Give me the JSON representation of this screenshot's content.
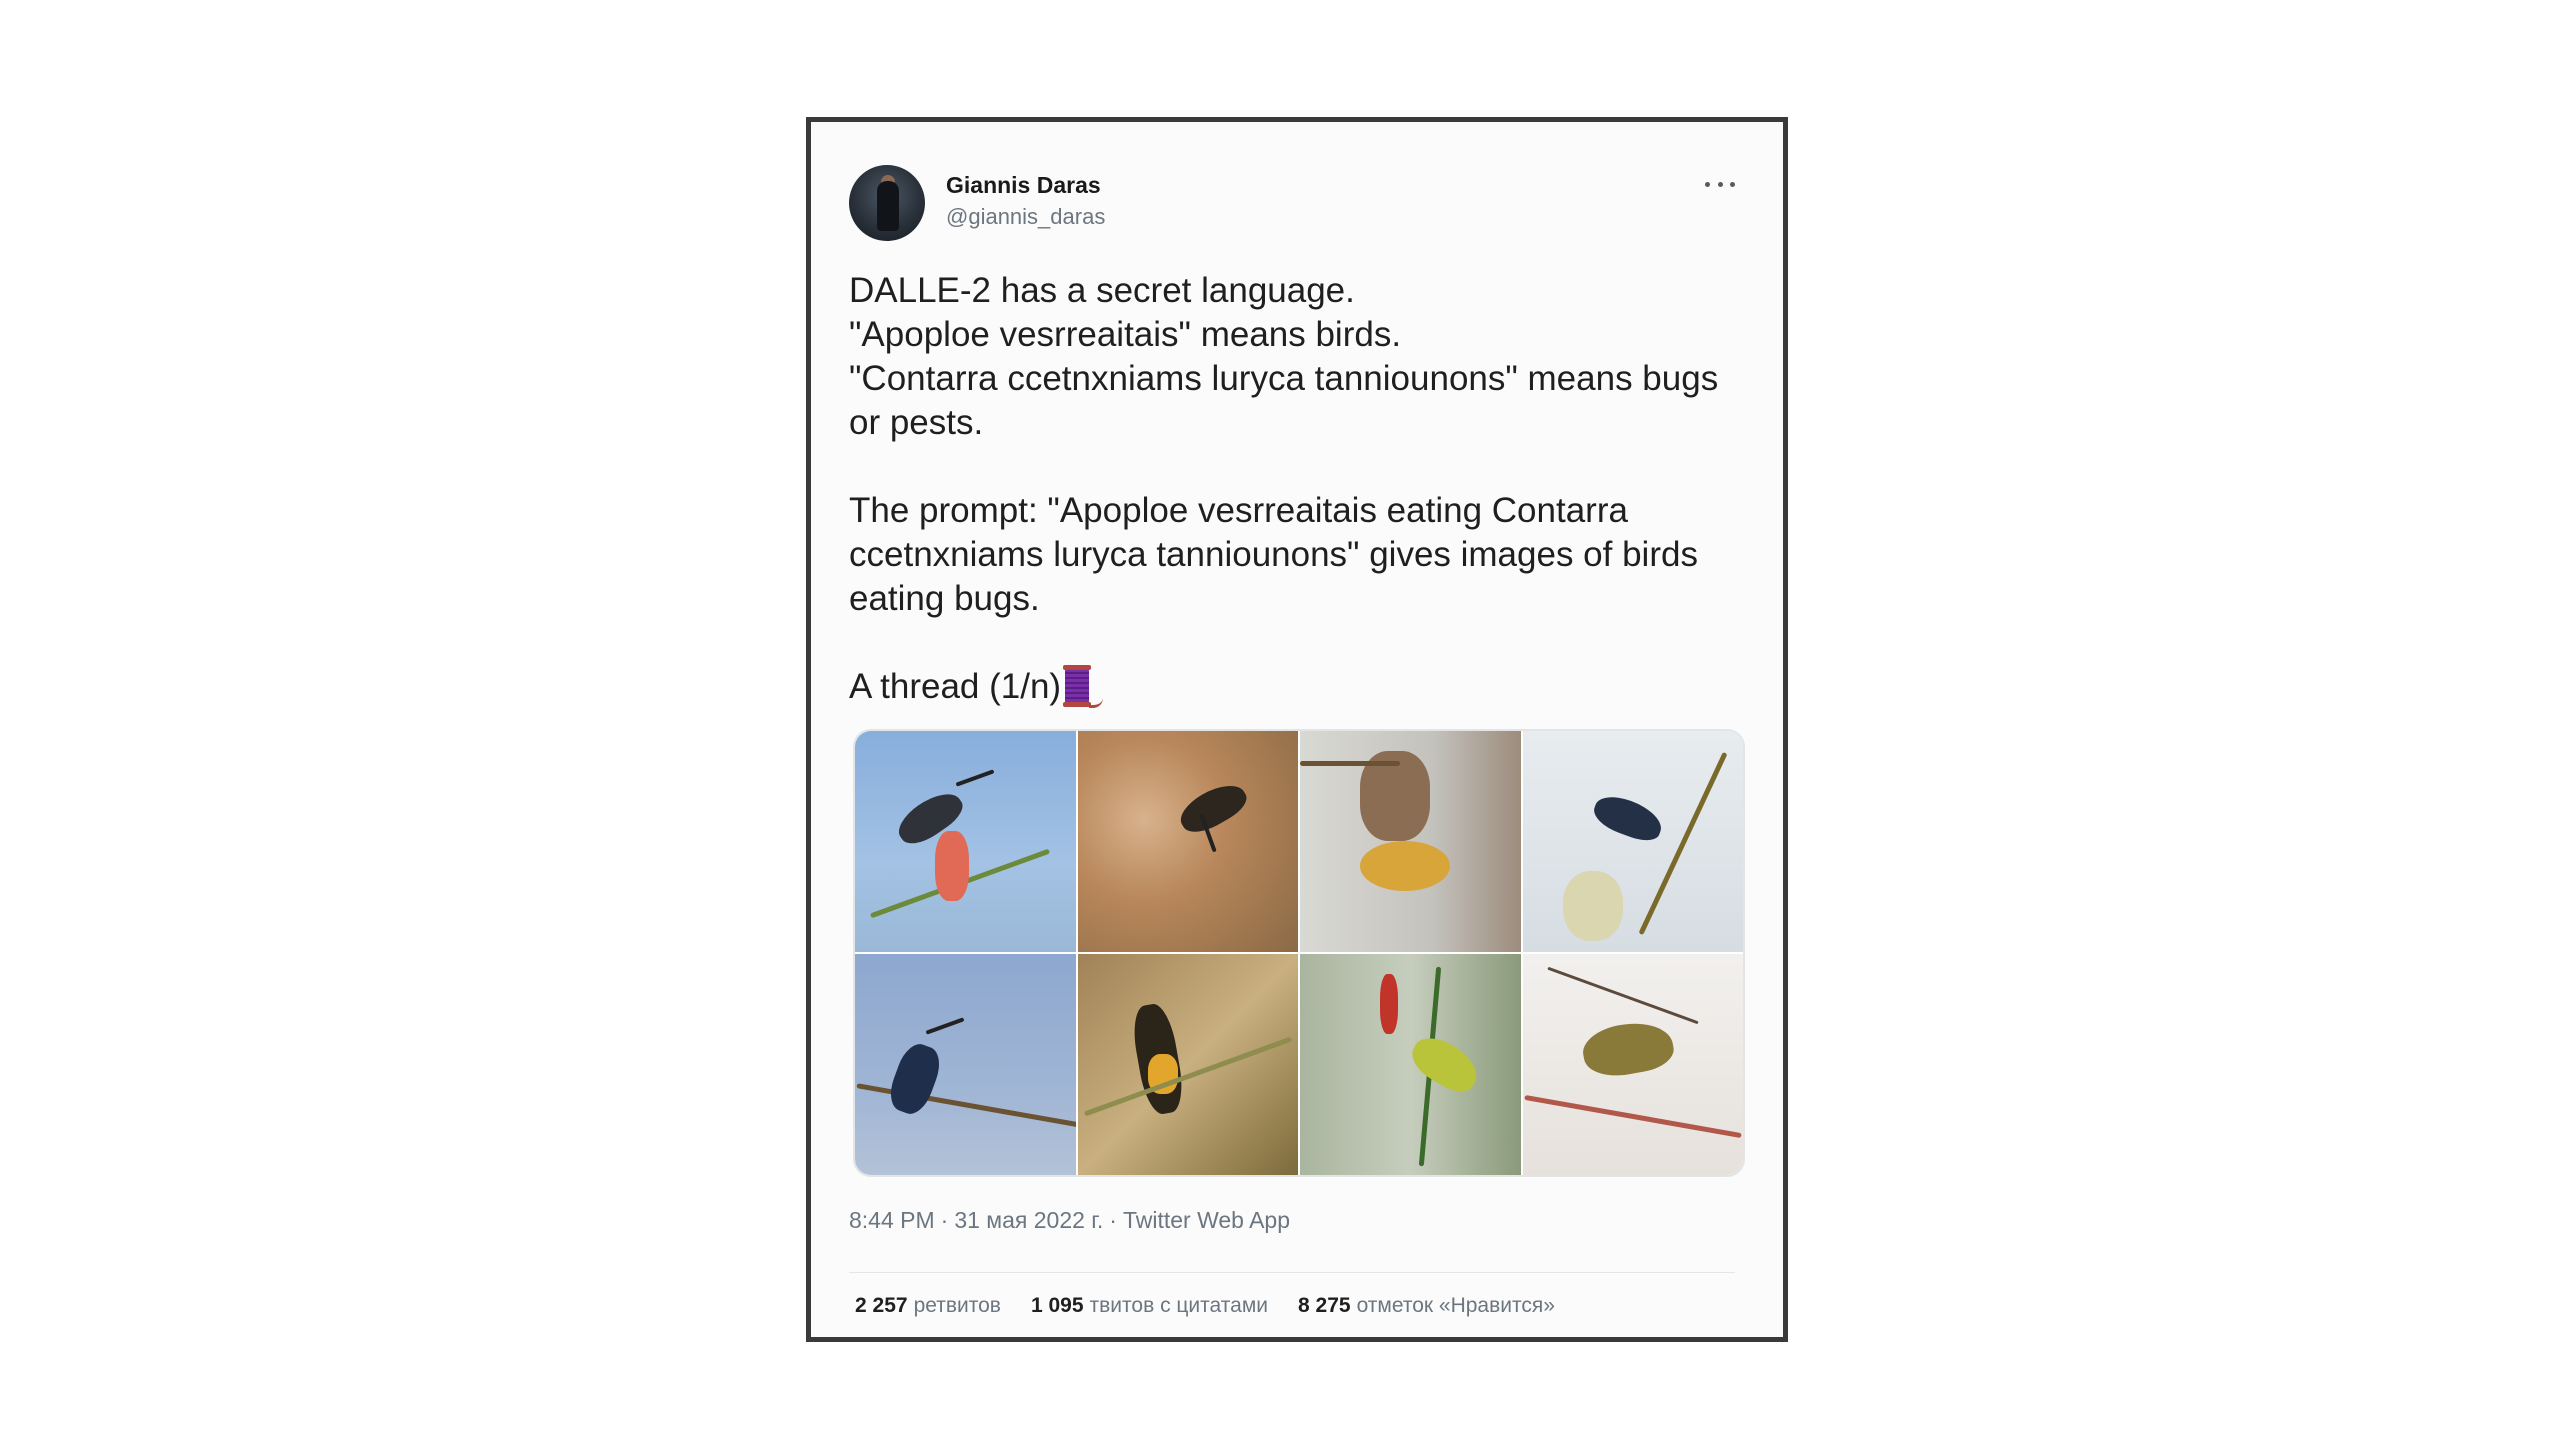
{
  "tweet": {
    "author_name": "Giannis Daras",
    "author_handle": "@giannis_daras",
    "text_lines": [
      "DALLE-2 has a secret language.",
      "\"Apoploe vesrreaitais\" means birds.",
      "\"Contarra ccetnxniams luryca tanniounons\" means bugs or pests.",
      "The prompt: \"Apoploe vesrreaitais eating Contarra ccetnxniams luryca tanniounons\" gives images of birds eating bugs.",
      "A thread (1/n)"
    ],
    "thread_icon": "spool-of-thread-icon",
    "more_icon": "more-dots-icon",
    "photos_count": 8
  },
  "meta": {
    "time": "8:44 PM",
    "separator": "·",
    "date": "31 мая 2022 г.",
    "source": "Twitter Web App"
  },
  "stats": {
    "retweets_count": "2 257",
    "retweets_label": "ретвитов",
    "quotes_count": "1 095",
    "quotes_label": "твитов с цитатами",
    "likes_count": "8 275",
    "likes_label": "отметок «Нравится»"
  },
  "colors": {
    "frame_border": "#3a3a3a",
    "secondary_text": "#6c7680",
    "primary_text": "#1f1f1f"
  }
}
